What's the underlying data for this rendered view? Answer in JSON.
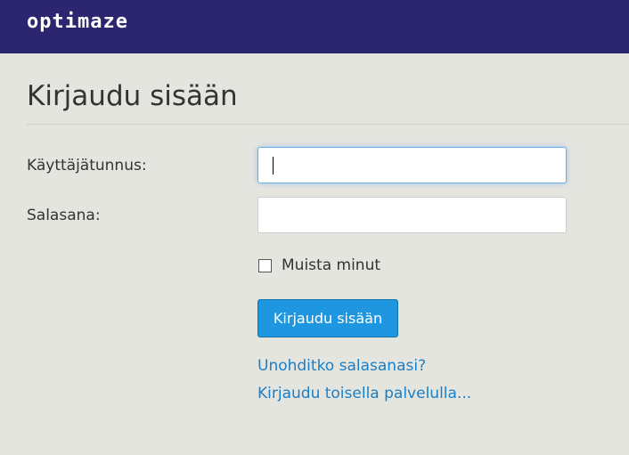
{
  "header": {
    "logo_text": "optimaze",
    "background_color": "#2c2670"
  },
  "login": {
    "title": "Kirjaudu sisään",
    "username_label": "Käyttäjätunnus:",
    "username_value": "",
    "password_label": "Salasana:",
    "password_value": "",
    "remember_label": "Muista minut",
    "remember_checked": false,
    "submit_label": "Kirjaudu sisään",
    "forgot_link": "Unohditko salasanasi?",
    "alt_login_link": "Kirjaudu toisella palvelulla..."
  },
  "colors": {
    "page_background": "#e5e5e0",
    "button_primary": "#1f97e0",
    "link": "#1a7fc4"
  }
}
